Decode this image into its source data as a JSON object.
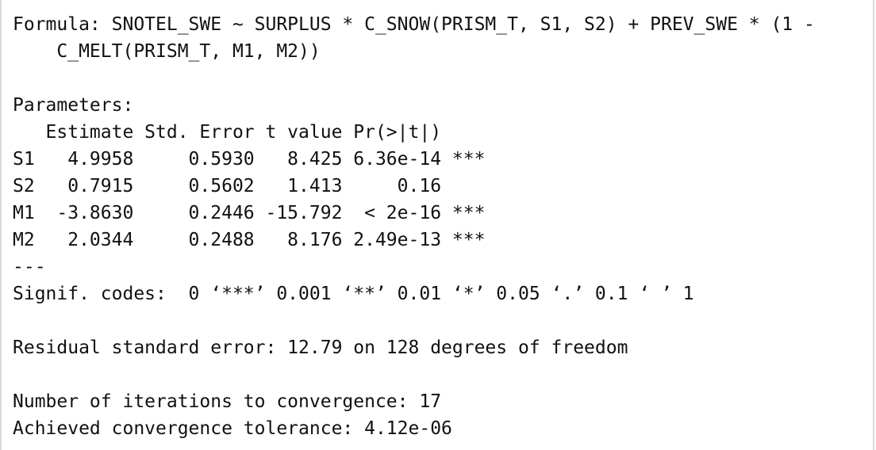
{
  "console": {
    "lines": [
      "Formula: SNOTEL_SWE ~ SURPLUS * C_SNOW(PRISM_T, S1, S2) + PREV_SWE * (1 -",
      "    C_MELT(PRISM_T, M1, M2))",
      "",
      "Parameters:",
      "   Estimate Std. Error t value Pr(>|t|)",
      "S1   4.9958     0.5930   8.425 6.36e-14 ***",
      "S2   0.7915     0.5602   1.413     0.16",
      "M1  -3.8630     0.2446 -15.792  < 2e-16 ***",
      "M2   2.0344     0.2488   8.176 2.49e-13 ***",
      "---",
      "Signif. codes:  0 ‘***’ 0.001 ‘**’ 0.01 ‘*’ 0.05 ‘.’ 0.1 ‘ ’ 1",
      "",
      "Residual standard error: 12.79 on 128 degrees of freedom",
      "",
      "Number of iterations to convergence: 17",
      "Achieved convergence tolerance: 4.12e-06"
    ]
  }
}
